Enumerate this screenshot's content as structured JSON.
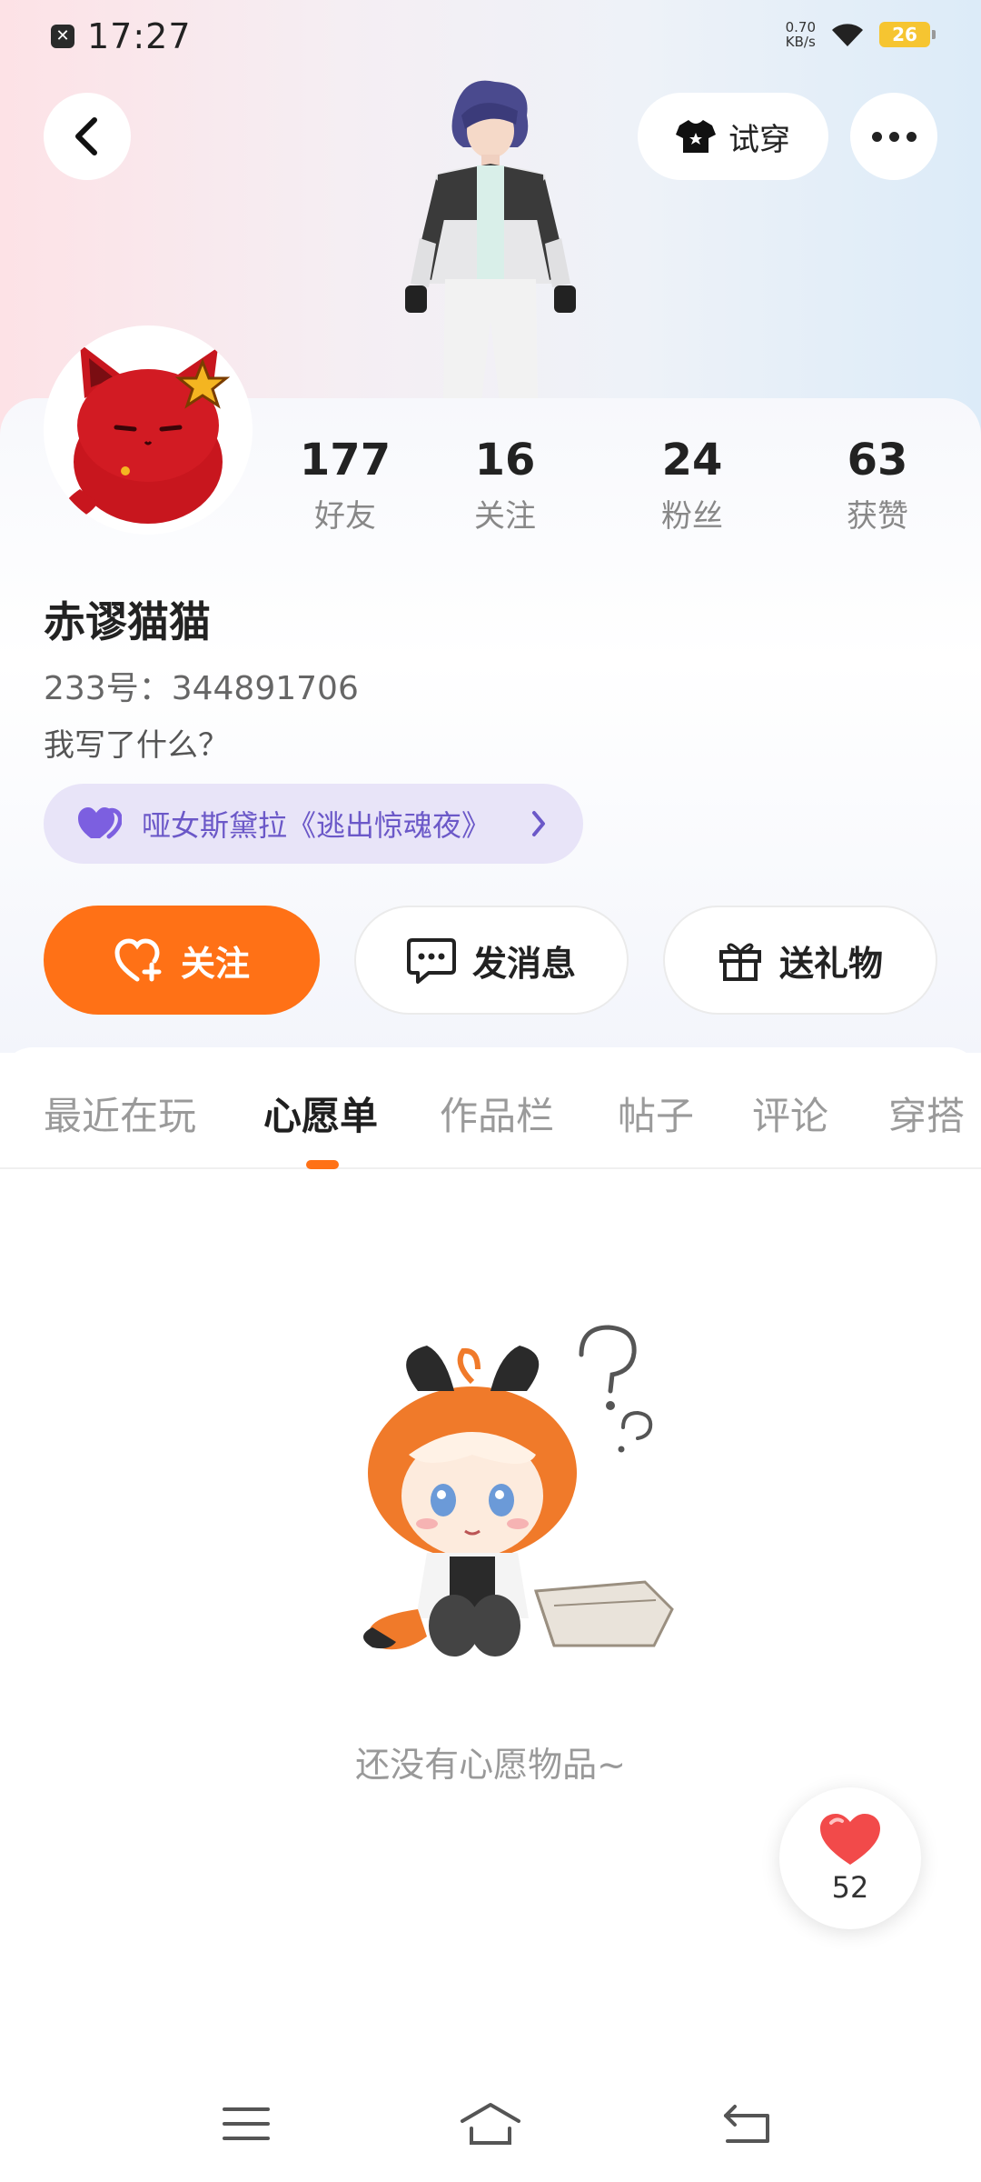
{
  "status_bar": {
    "time": "17:27",
    "net_speed_value": "0.70",
    "net_speed_unit": "KB/s",
    "battery": "26"
  },
  "header": {
    "try_on_label": "试穿"
  },
  "profile": {
    "name": "赤谬猫猫",
    "uid": "233号：344891706",
    "bio": "我写了什么？",
    "stats": [
      {
        "value": "177",
        "label": "好友"
      },
      {
        "value": "16",
        "label": "关注"
      },
      {
        "value": "24",
        "label": "粉丝"
      },
      {
        "value": "63",
        "label": "获赞"
      }
    ],
    "game_chip": "哑女斯黛拉《逃出惊魂夜》"
  },
  "actions": {
    "follow": "关注",
    "message": "发消息",
    "gift": "送礼物"
  },
  "tabs": [
    {
      "label": "最近在玩"
    },
    {
      "label": "心愿单"
    },
    {
      "label": "作品栏"
    },
    {
      "label": "帖子"
    },
    {
      "label": "评论"
    },
    {
      "label": "穿搭"
    }
  ],
  "active_tab": "心愿单",
  "empty_state": {
    "text": "还没有心愿物品~"
  },
  "like_fab": {
    "count": "52"
  },
  "colors": {
    "accent": "#ff7116",
    "chip_bg": "#e8e4f8",
    "chip_text": "#6b58c8"
  }
}
